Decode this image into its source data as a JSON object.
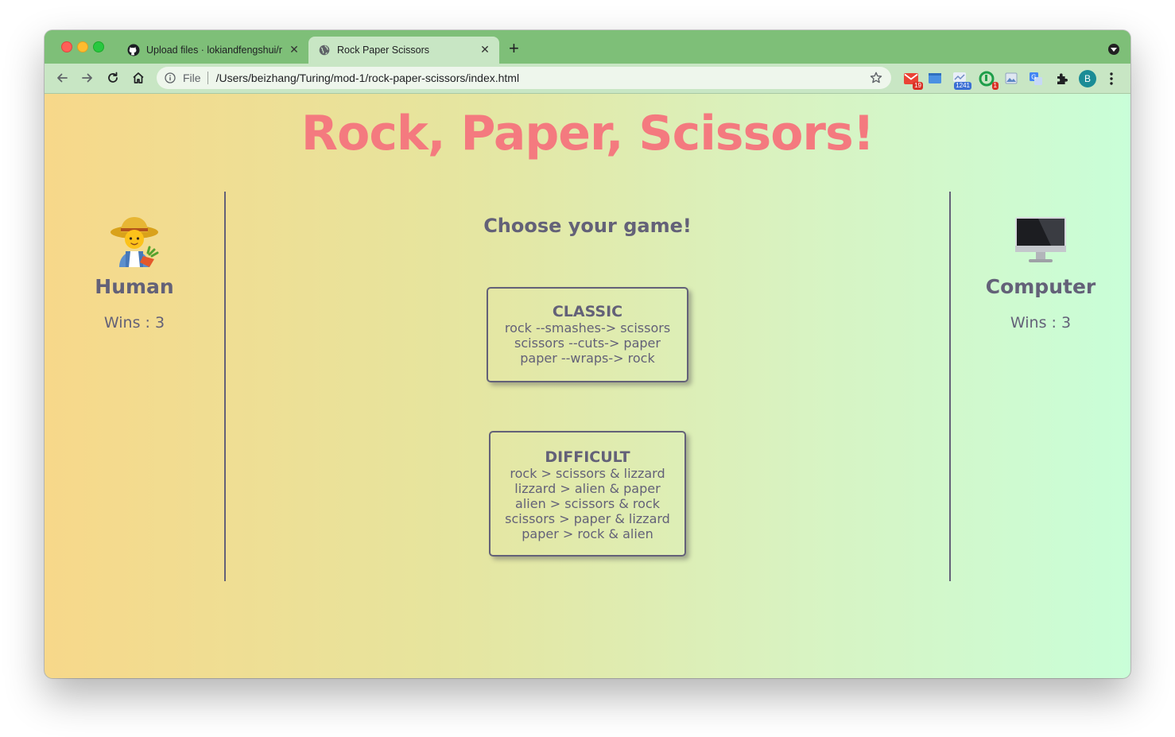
{
  "browser": {
    "tabs": [
      {
        "title": "Upload files · lokiandfengshui/r",
        "icon": "github-icon",
        "active": false
      },
      {
        "title": "Rock Paper Scissors",
        "icon": "globe-icon",
        "active": true
      }
    ],
    "address": {
      "scheme": "File",
      "url": "/Users/beizhang/Turing/mod-1/rock-paper-scissors/index.html"
    },
    "extensions": [
      {
        "name": "gmail-extension-icon",
        "badge": "19"
      },
      {
        "name": "window-extension-icon",
        "badge": ""
      },
      {
        "name": "counter-extension-icon",
        "badge": "1241"
      },
      {
        "name": "green-circle-extension-icon",
        "badge": "1"
      },
      {
        "name": "image-extension-icon",
        "badge": ""
      },
      {
        "name": "translate-extension-icon",
        "badge": ""
      }
    ],
    "profile_initial": "B",
    "colors": {
      "frame": "#7ebf78",
      "toolbar": "#c8e6c4"
    }
  },
  "page": {
    "title": "Rock, Paper, Scissors!",
    "human": {
      "icon": "farmer-emoji-icon",
      "name": "Human",
      "wins": "Wins : 3"
    },
    "computer": {
      "icon": "desktop-computer-icon",
      "name": "Computer",
      "wins": "Wins : 3"
    },
    "choose_prompt": "Choose your game!",
    "games": [
      {
        "title": "CLASSIC",
        "rules": [
          "rock --smashes-> scissors",
          "scissors --cuts-> paper",
          "paper --wraps-> rock"
        ]
      },
      {
        "title": "DIFFICULT",
        "rules": [
          "rock > scissors & lizzard",
          "lizzard > alien & paper",
          "alien > scissors & rock",
          "scissors > paper & lizzard",
          "paper > rock & alien"
        ]
      }
    ],
    "colors": {
      "title": "#f47a7f",
      "text": "#636178",
      "gradient_start": "#f7d88a",
      "gradient_end": "#c9fed8"
    }
  }
}
